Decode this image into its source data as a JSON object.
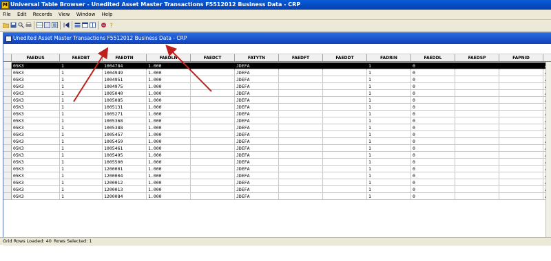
{
  "app": {
    "title": "Universal Table Browser - Unedited Asset Master Transactions  F5512012  Business Data - CRP"
  },
  "menu": [
    "File",
    "Edit",
    "Records",
    "View",
    "Window",
    "Help"
  ],
  "toolbar_icons": [
    "open-icon",
    "save-icon",
    "find-icon",
    "print-icon",
    "grid-icon",
    "export-icon",
    "filter-icon",
    "first-icon",
    "prev-icon",
    "next-icon",
    "last-icon",
    "delete-icon",
    "help-icon"
  ],
  "child": {
    "title": "Unedited Asset Master Transactions  F5512012  Business Data - CRP"
  },
  "columns": [
    "FAEDUS",
    "FAEDBT",
    "FAEDTN",
    "FAEDLN",
    "FAEDCT",
    "FATYTN",
    "FAEDFT",
    "FAEDDT",
    "FADRIN",
    "FAEDDL",
    "FAEDSP",
    "FAPNID",
    ""
  ],
  "rows": [
    [
      "05K3",
      "1",
      "1004784",
      "1.000",
      "",
      "JDEFA",
      "",
      "",
      "1",
      "0",
      "",
      "",
      "A"
    ],
    [
      "05K3",
      "1",
      "1004949",
      "1.000",
      "",
      "JDEFA",
      "",
      "",
      "1",
      "0",
      "",
      "",
      "A"
    ],
    [
      "05K3",
      "1",
      "1004951",
      "1.000",
      "",
      "JDEFA",
      "",
      "",
      "1",
      "0",
      "",
      "",
      "A"
    ],
    [
      "05K3",
      "1",
      "1004975",
      "1.000",
      "",
      "JDEFA",
      "",
      "",
      "1",
      "0",
      "",
      "",
      "A"
    ],
    [
      "05K3",
      "1",
      "1005040",
      "1.000",
      "",
      "JDEFA",
      "",
      "",
      "1",
      "0",
      "",
      "",
      "A"
    ],
    [
      "05K3",
      "1",
      "1005085",
      "1.000",
      "",
      "JDEFA",
      "",
      "",
      "1",
      "0",
      "",
      "",
      "A"
    ],
    [
      "05K3",
      "1",
      "1005131",
      "1.000",
      "",
      "JDEFA",
      "",
      "",
      "1",
      "0",
      "",
      "",
      "A"
    ],
    [
      "05K3",
      "1",
      "1005271",
      "1.000",
      "",
      "JDEFA",
      "",
      "",
      "1",
      "0",
      "",
      "",
      "A"
    ],
    [
      "05K3",
      "1",
      "1005368",
      "1.000",
      "",
      "JDEFA",
      "",
      "",
      "1",
      "0",
      "",
      "",
      "A"
    ],
    [
      "05K3",
      "1",
      "1005388",
      "1.000",
      "",
      "JDEFA",
      "",
      "",
      "1",
      "0",
      "",
      "",
      "A"
    ],
    [
      "05K3",
      "1",
      "1005457",
      "1.000",
      "",
      "JDEFA",
      "",
      "",
      "1",
      "0",
      "",
      "",
      "A"
    ],
    [
      "05K3",
      "1",
      "1005459",
      "1.000",
      "",
      "JDEFA",
      "",
      "",
      "1",
      "0",
      "",
      "",
      "A"
    ],
    [
      "05K3",
      "1",
      "1005461",
      "1.000",
      "",
      "JDEFA",
      "",
      "",
      "1",
      "0",
      "",
      "",
      "A"
    ],
    [
      "05K3",
      "1",
      "1005495",
      "1.000",
      "",
      "JDEFA",
      "",
      "",
      "1",
      "0",
      "",
      "",
      "A"
    ],
    [
      "05K3",
      "1",
      "1005500",
      "1.000",
      "",
      "JDEFA",
      "",
      "",
      "1",
      "0",
      "",
      "",
      "A"
    ],
    [
      "05K3",
      "1",
      "1200001",
      "1.000",
      "",
      "JDEFA",
      "",
      "",
      "1",
      "0",
      "",
      "",
      "A"
    ],
    [
      "05K3",
      "1",
      "1200004",
      "1.000",
      "",
      "JDEFA",
      "",
      "",
      "1",
      "0",
      "",
      "",
      "A"
    ],
    [
      "05K3",
      "1",
      "1200012",
      "1.000",
      "",
      "JDEFA",
      "",
      "",
      "1",
      "0",
      "",
      "",
      "A"
    ],
    [
      "05K3",
      "1",
      "1200013",
      "1.000",
      "",
      "JDEFA",
      "",
      "",
      "1",
      "0",
      "",
      "",
      "A"
    ],
    [
      "05K3",
      "1",
      "1200084",
      "1.000",
      "",
      "JDEFA",
      "",
      "",
      "1",
      "0",
      "",
      "",
      "A"
    ]
  ],
  "selected_row": 0,
  "status": {
    "grid_rows": "Grid Rows Loaded: 40",
    "rows_selected": "Rows Selected: 1"
  },
  "colors": {
    "title_bar": "#0a5bd8",
    "selected_row": "#000000",
    "annotation_arrow": "#c0201c"
  }
}
